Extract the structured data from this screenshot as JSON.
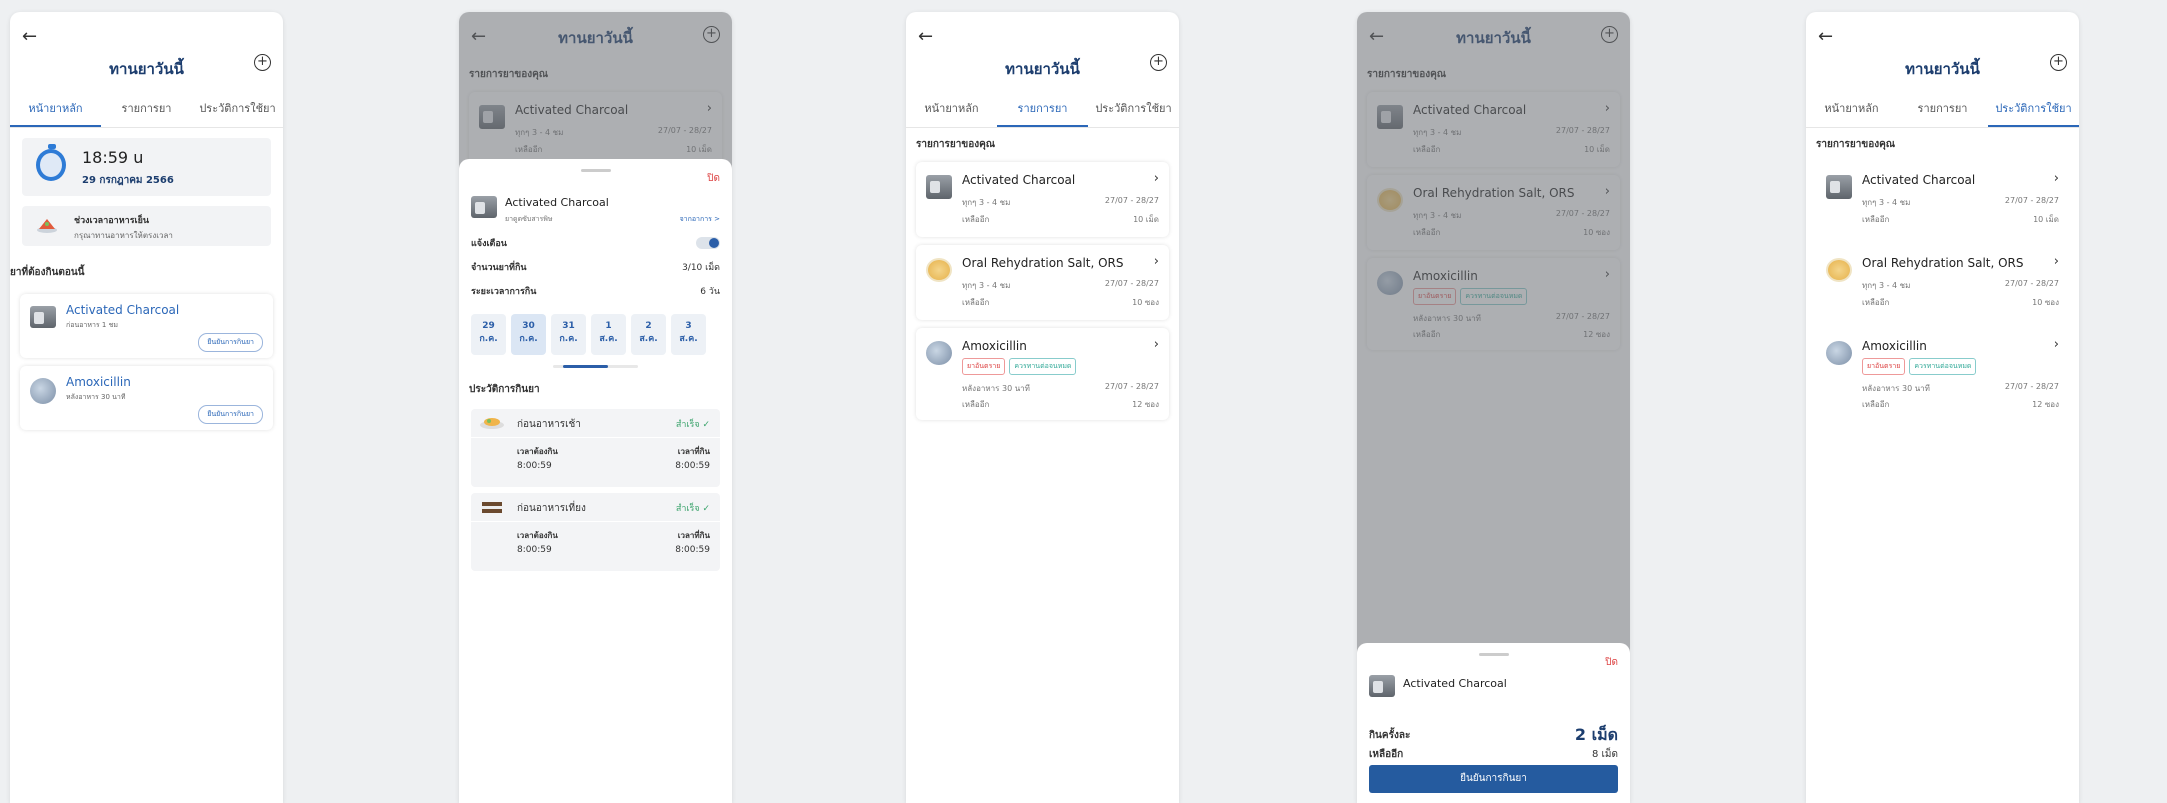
{
  "app": {
    "title": "ทานยาวันนี้",
    "tabs": [
      "หน้ายาหลัก",
      "รายการยา",
      "ประวัติการใช้ยา"
    ],
    "my_meds_label": "รายการยาของคุณ"
  },
  "colors": {
    "brand": "#1c3d6e",
    "accent": "#2b67b8",
    "danger": "#dd4444",
    "success": "#3aa36b"
  },
  "icons": {
    "back": "arrow-left-icon",
    "add": "plus-circle-icon",
    "chevron": "chevron-right-icon",
    "check": "check-icon"
  },
  "meds": [
    {
      "name": "Activated Charcoal",
      "freq": "ทุกๆ 3 - 4 ชม",
      "dates": "27/07 - 28/27",
      "remain_label": "เหลืออีก",
      "remain": "10 เม็ด"
    },
    {
      "name": "Oral Rehydration Salt, ORS",
      "freq": "ทุกๆ 3 - 4 ชม",
      "dates": "27/07 - 28/27",
      "remain_label": "เหลืออีก",
      "remain": "10 ซอง"
    },
    {
      "name": "Amoxicillin",
      "tags": [
        "ยาอันตราย",
        "ควรทานต่อจนหมด"
      ],
      "freq": "หลังอาหาร 30 นาที",
      "dates": "27/07 - 28/27",
      "remain_label": "เหลืออีก",
      "remain": "12 ซอง"
    }
  ],
  "home": {
    "time": "18:59 u",
    "date": "29 กรกฎาคม 2566",
    "meal_title": "ช่วงเวลาอาหารเย็น",
    "meal_sub": "กรุณาทานอาหารให้ตรงเวลา",
    "due_label": "ยาที่ต้องกินตอนนี้",
    "due": [
      {
        "name": "Activated Charcoal",
        "sub": "ก่อนอาหาร 1 ชม",
        "button": "ยืนยันการกินยา"
      },
      {
        "name": "Amoxicillin",
        "sub": "หลังอาหาร 30 นาที",
        "button": "ยืนยันการกินยา"
      }
    ]
  },
  "detail_sheet": {
    "close": "ปิด",
    "name": "Activated Charcoal",
    "sub": "ยาดูดซับสารพิษ",
    "from": "จากอาการ >",
    "notify_label": "แจ้งเตือน",
    "count_label": "จำนวนยาที่กิน",
    "count_value": "3/10 เม็ด",
    "period_label": "ระยะเวลาการกิน",
    "period_value": "6 วัน",
    "days": [
      {
        "d": "29",
        "m": "ก.ค."
      },
      {
        "d": "30",
        "m": "ก.ค."
      },
      {
        "d": "31",
        "m": "ก.ค."
      },
      {
        "d": "1",
        "m": "ส.ค."
      },
      {
        "d": "2",
        "m": "ส.ค."
      },
      {
        "d": "3",
        "m": "ส.ค."
      }
    ],
    "history_label": "ประวัติการกินยา",
    "history": [
      {
        "title": "ก่อนอาหารเช้า",
        "status": "สำเร็จ ✓",
        "k1": "เวลาต้องกิน",
        "v1": "8:00:59",
        "k2": "เวลาที่กิน",
        "v2": "8:00:59"
      },
      {
        "title": "ก่อนอาหารเที่ยง",
        "status": "สำเร็จ ✓",
        "k1": "เวลาต้องกิน",
        "v1": "8:00:59",
        "k2": "เวลาที่กิน",
        "v2": "8:00:59"
      }
    ]
  },
  "confirm_sheet": {
    "close": "ปิด",
    "name": "Activated Charcoal",
    "dose_label": "กินครั้งละ",
    "dose_value": "2 เม็ด",
    "remain_label": "เหลืออีก",
    "remain_value": "8 เม็ด",
    "button": "ยืนยันการกินยา"
  }
}
